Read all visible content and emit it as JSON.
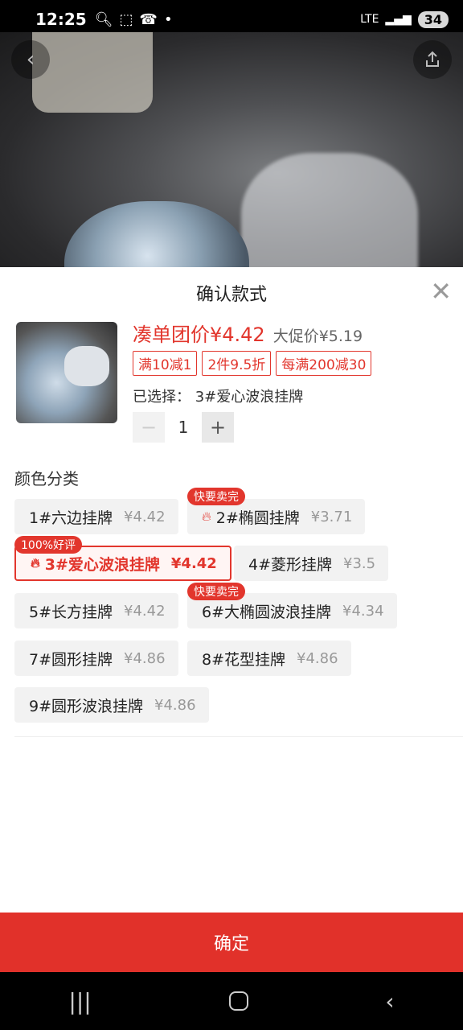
{
  "status_bar": {
    "time": "12:25",
    "network": "LTE",
    "battery": "34"
  },
  "sheet": {
    "title": "确认款式",
    "price_main": "凑单团价¥4.42",
    "price_promo": "大促价¥5.19",
    "coupons": [
      "满10减1",
      "2件9.5折",
      "每满200减30"
    ],
    "selected_text": "已选择： 3#爱心波浪挂牌",
    "quantity": "1",
    "section_label": "颜色分类",
    "options": [
      {
        "label": "1#六边挂牌",
        "price": "¥4.42",
        "badge": ""
      },
      {
        "label": "2#椭圆挂牌",
        "price": "¥3.71",
        "badge": "快要卖完"
      },
      {
        "label": "3#爱心波浪挂牌",
        "price": "¥4.42",
        "badge": "100%好评"
      },
      {
        "label": "4#菱形挂牌",
        "price": "¥3.5",
        "badge": ""
      },
      {
        "label": "5#长方挂牌",
        "price": "¥4.42",
        "badge": ""
      },
      {
        "label": "6#大椭圆波浪挂牌",
        "price": "¥4.34",
        "badge": "快要卖完"
      },
      {
        "label": "7#圆形挂牌",
        "price": "¥4.86",
        "badge": ""
      },
      {
        "label": "8#花型挂牌",
        "price": "¥4.86",
        "badge": ""
      },
      {
        "label": "9#圆形波浪挂牌",
        "price": "¥4.86",
        "badge": ""
      }
    ],
    "selected_option_index": 2,
    "confirm_label": "确定"
  },
  "icons": [
    "back-icon",
    "share-icon",
    "close-icon",
    "flame-icon",
    "minus-icon",
    "plus-icon",
    "recent-apps-icon",
    "home-icon",
    "nav-back-icon"
  ],
  "colors": {
    "accent": "#e2362d",
    "confirm_bg": "#e1312a"
  }
}
